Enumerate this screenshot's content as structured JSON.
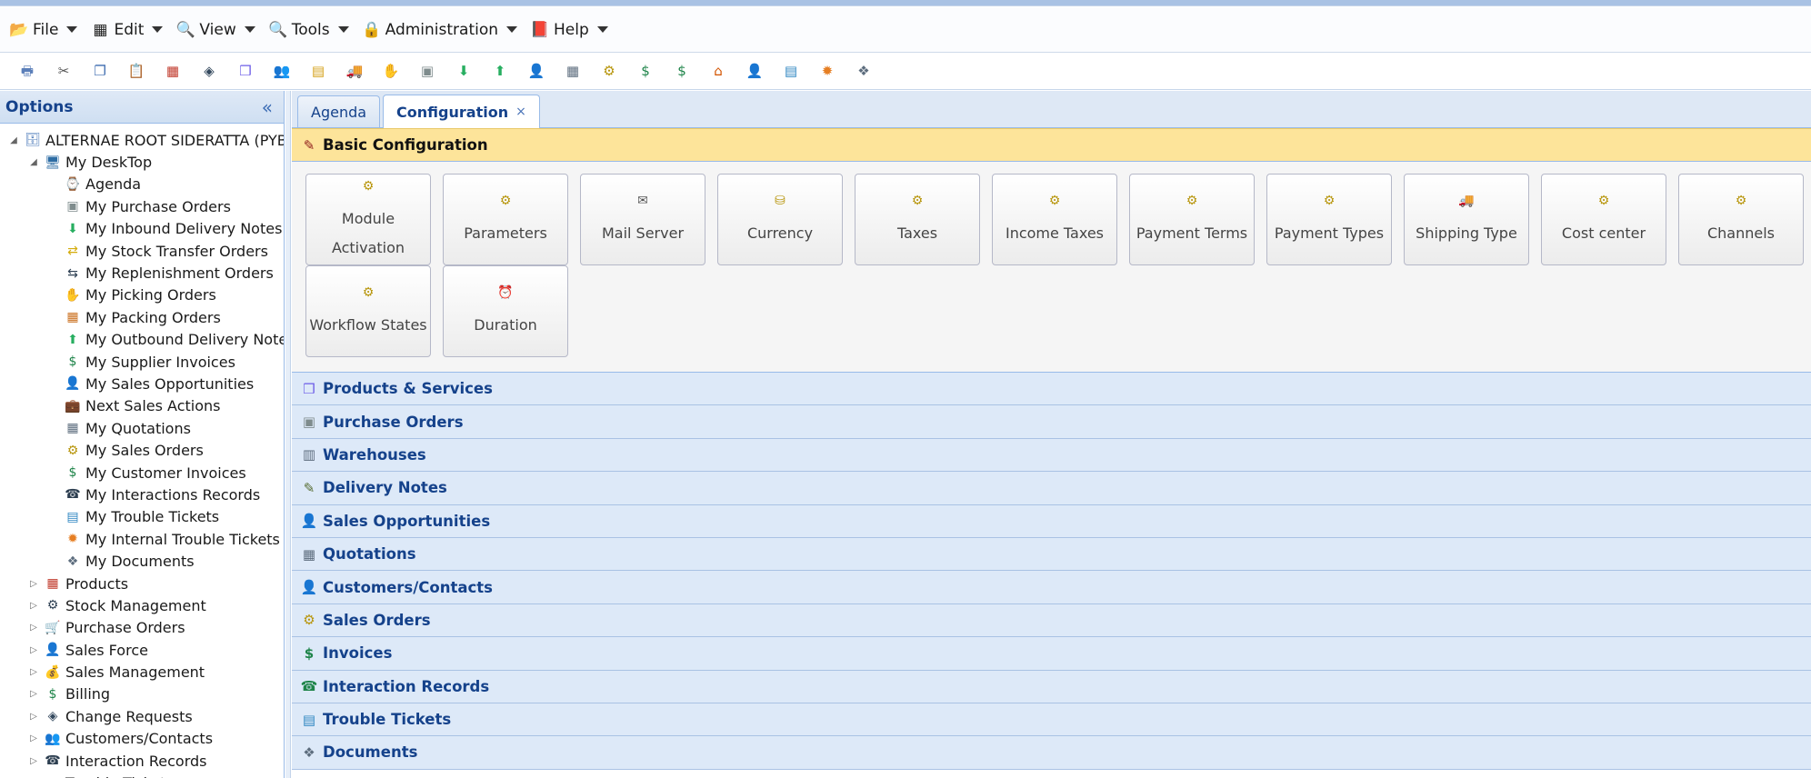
{
  "menubar": {
    "items": [
      {
        "label": "File",
        "icon": "file-icon",
        "glyph": "📂"
      },
      {
        "label": "Edit",
        "icon": "edit-icon",
        "glyph": "▦"
      },
      {
        "label": "View",
        "icon": "view-icon",
        "glyph": "🔍"
      },
      {
        "label": "Tools",
        "icon": "tools-icon",
        "glyph": "🔍"
      },
      {
        "label": "Administration",
        "icon": "lock-icon",
        "glyph": "🔒"
      },
      {
        "label": "Help",
        "icon": "help-book-icon",
        "glyph": "📕"
      }
    ]
  },
  "toolbar": {
    "buttons": [
      {
        "name": "print-icon",
        "glyph": "🖶",
        "color": "#5b7fb9"
      },
      {
        "name": "cut-icon",
        "glyph": "✂",
        "color": "#555555"
      },
      {
        "name": "copy-icon",
        "glyph": "❐",
        "color": "#3e6cb0"
      },
      {
        "name": "paste-icon",
        "glyph": "📋",
        "color": "#8a6d3b"
      },
      {
        "name": "calendar-icon",
        "glyph": "▦",
        "color": "#c0392b"
      },
      {
        "name": "stack-icon",
        "glyph": "◈",
        "color": "#34495e"
      },
      {
        "name": "product-box-icon",
        "glyph": "❒",
        "color": "#6c5ce7"
      },
      {
        "name": "users-group-icon",
        "glyph": "👥",
        "color": "#222222"
      },
      {
        "name": "notes-icon",
        "glyph": "▤",
        "color": "#d4a017"
      },
      {
        "name": "truck-icon",
        "glyph": "🚚",
        "color": "#b8860b"
      },
      {
        "name": "hand-box-icon",
        "glyph": "✋",
        "color": "#e67e22"
      },
      {
        "name": "purchase-order-icon",
        "glyph": "▣",
        "color": "#7f8c8d"
      },
      {
        "name": "inbound-icon",
        "glyph": "⬇",
        "color": "#27ae60"
      },
      {
        "name": "outbound-icon",
        "glyph": "⬆",
        "color": "#27ae60"
      },
      {
        "name": "sales-person-icon",
        "glyph": "👤",
        "color": "#8e1b1b"
      },
      {
        "name": "calculator-icon",
        "glyph": "▦",
        "color": "#5d6d7e"
      },
      {
        "name": "sales-order-icon",
        "glyph": "⚙",
        "color": "#b7950b"
      },
      {
        "name": "invoice-icon",
        "glyph": "$",
        "color": "#1e8449"
      },
      {
        "name": "customer-invoice-icon",
        "glyph": "$",
        "color": "#1e8449"
      },
      {
        "name": "warehouse-house-icon",
        "glyph": "⌂",
        "color": "#d35400"
      },
      {
        "name": "contact-person-icon",
        "glyph": "👤",
        "color": "#333333"
      },
      {
        "name": "ticket-icon",
        "glyph": "▤",
        "color": "#2e86c1"
      },
      {
        "name": "bug-icon",
        "glyph": "✹",
        "color": "#e67e22"
      },
      {
        "name": "documents-icon",
        "glyph": "❖",
        "color": "#5d6d7e"
      }
    ]
  },
  "left_panel": {
    "title": "Options",
    "tree": [
      {
        "level": 0,
        "toggle": "◢",
        "label": "ALTERNAE ROOT SIDERATTA (PYB)",
        "icon": "database-icon",
        "glyph": "🗄",
        "color": "#4a78b8"
      },
      {
        "level": 1,
        "toggle": "◢",
        "label": "My DeskTop",
        "icon": "desktop-icon",
        "glyph": "🖥",
        "color": "#2e6da4"
      },
      {
        "level": 2,
        "toggle": "",
        "label": "Agenda",
        "icon": "agenda-icon",
        "glyph": "⌚",
        "color": "#b8860b"
      },
      {
        "level": 2,
        "toggle": "",
        "label": "My Purchase Orders",
        "icon": "purchase-order-icon",
        "glyph": "▣",
        "color": "#7f8c8d"
      },
      {
        "level": 2,
        "toggle": "",
        "label": "My Inbound Delivery Notes",
        "icon": "inbound-icon",
        "glyph": "⬇",
        "color": "#27ae60"
      },
      {
        "level": 2,
        "toggle": "",
        "label": "My Stock Transfer Orders",
        "icon": "stock-transfer-icon",
        "glyph": "⇄",
        "color": "#d4ac0d"
      },
      {
        "level": 2,
        "toggle": "",
        "label": "My Replenishment Orders",
        "icon": "replenish-icon",
        "glyph": "⇆",
        "color": "#2e4053"
      },
      {
        "level": 2,
        "toggle": "",
        "label": "My Picking Orders",
        "icon": "picking-icon",
        "glyph": "✋",
        "color": "#e67e22"
      },
      {
        "level": 2,
        "toggle": "",
        "label": "My Packing Orders",
        "icon": "packing-icon",
        "glyph": "▦",
        "color": "#ca6f1e"
      },
      {
        "level": 2,
        "toggle": "",
        "label": "My Outbound Delivery Notes",
        "icon": "outbound-icon",
        "glyph": "⬆",
        "color": "#27ae60"
      },
      {
        "level": 2,
        "toggle": "",
        "label": "My Supplier Invoices",
        "icon": "invoice-icon",
        "glyph": "$",
        "color": "#1e8449"
      },
      {
        "level": 2,
        "toggle": "",
        "label": "My Sales Opportunities",
        "icon": "sales-person-icon",
        "glyph": "👤",
        "color": "#8e1b1b"
      },
      {
        "level": 2,
        "toggle": "",
        "label": "Next Sales Actions",
        "icon": "briefcase-icon",
        "glyph": "💼",
        "color": "#922b21"
      },
      {
        "level": 2,
        "toggle": "",
        "label": "My Quotations",
        "icon": "calculator-icon",
        "glyph": "▦",
        "color": "#5d6d7e"
      },
      {
        "level": 2,
        "toggle": "",
        "label": "My Sales Orders",
        "icon": "sales-order-icon",
        "glyph": "⚙",
        "color": "#b7950b"
      },
      {
        "level": 2,
        "toggle": "",
        "label": "My Customer Invoices",
        "icon": "customer-invoice-icon",
        "glyph": "$",
        "color": "#1e8449"
      },
      {
        "level": 2,
        "toggle": "",
        "label": "My Interactions Records",
        "icon": "interaction-icon",
        "glyph": "☎",
        "color": "#2c3e50"
      },
      {
        "level": 2,
        "toggle": "",
        "label": "My Trouble Tickets",
        "icon": "ticket-icon",
        "glyph": "▤",
        "color": "#2e86c1"
      },
      {
        "level": 2,
        "toggle": "",
        "label": "My Internal Trouble Tickets",
        "icon": "bug-icon",
        "glyph": "✹",
        "color": "#e67e22"
      },
      {
        "level": 2,
        "toggle": "",
        "label": "My Documents",
        "icon": "documents-icon",
        "glyph": "❖",
        "color": "#5d6d7e"
      },
      {
        "level": 1,
        "toggle": "▷",
        "label": "Products",
        "icon": "products-icon",
        "glyph": "▦",
        "color": "#c0392b"
      },
      {
        "level": 1,
        "toggle": "▷",
        "label": "Stock Management",
        "icon": "stock-icon",
        "glyph": "⚙",
        "color": "#2e4053"
      },
      {
        "level": 1,
        "toggle": "▷",
        "label": "Purchase Orders",
        "icon": "cart-icon",
        "glyph": "🛒",
        "color": "#1e8449"
      },
      {
        "level": 1,
        "toggle": "▷",
        "label": "Sales Force",
        "icon": "sales-force-icon",
        "glyph": "👤",
        "color": "#7d6608"
      },
      {
        "level": 1,
        "toggle": "▷",
        "label": "Sales Management",
        "icon": "money-bag-icon",
        "glyph": "💰",
        "color": "#b9770e"
      },
      {
        "level": 1,
        "toggle": "▷",
        "label": "Billing",
        "icon": "billing-icon",
        "glyph": "$",
        "color": "#1e8449"
      },
      {
        "level": 1,
        "toggle": "▷",
        "label": "Change Requests",
        "icon": "change-request-icon",
        "glyph": "◈",
        "color": "#34495e"
      },
      {
        "level": 1,
        "toggle": "▷",
        "label": "Customers/Contacts",
        "icon": "customers-icon",
        "glyph": "👥",
        "color": "#b9770e"
      },
      {
        "level": 1,
        "toggle": "▷",
        "label": "Interaction Records",
        "icon": "interaction-records-icon",
        "glyph": "☎",
        "color": "#2c3e50"
      },
      {
        "level": 1,
        "toggle": "▷",
        "label": "Trouble Tickets",
        "icon": "ticket-icon",
        "glyph": "▤",
        "color": "#2e86c1"
      }
    ]
  },
  "tabs": [
    {
      "label": "Agenda",
      "active": false,
      "closable": false
    },
    {
      "label": "Configuration",
      "active": true,
      "closable": true,
      "close_glyph": "×"
    }
  ],
  "basic_config": {
    "title": "Basic Configuration",
    "icon": "config-icon",
    "glyph": "✎",
    "buttons": [
      {
        "label": "Module Activation",
        "icon": "module-icon",
        "glyph": "⚙",
        "color": "#b7950b"
      },
      {
        "label": "Parameters",
        "icon": "parameters-icon",
        "glyph": "⚙",
        "color": "#b7950b"
      },
      {
        "label": "Mail Server",
        "icon": "mail-icon",
        "glyph": "✉",
        "color": "#555555"
      },
      {
        "label": "Currency",
        "icon": "currency-icon",
        "glyph": "⛁",
        "color": "#b7950b"
      },
      {
        "label": "Taxes",
        "icon": "taxes-icon",
        "glyph": "⚙",
        "color": "#b7950b"
      },
      {
        "label": "Income Taxes",
        "icon": "income-taxes-icon",
        "glyph": "⚙",
        "color": "#b7950b"
      },
      {
        "label": "Payment Terms",
        "icon": "payment-terms-icon",
        "glyph": "⚙",
        "color": "#b7950b"
      },
      {
        "label": "Payment Types",
        "icon": "payment-types-icon",
        "glyph": "⚙",
        "color": "#b7950b"
      },
      {
        "label": "Shipping Type",
        "icon": "shipping-truck-icon",
        "glyph": "🚚",
        "color": "#c0392b"
      },
      {
        "label": "Cost center",
        "icon": "cost-center-icon",
        "glyph": "⚙",
        "color": "#b7950b"
      },
      {
        "label": "Channels",
        "icon": "channels-icon",
        "glyph": "⚙",
        "color": "#b7950b"
      },
      {
        "label": "Workflow States",
        "icon": "workflow-icon",
        "glyph": "⚙",
        "color": "#b7950b"
      },
      {
        "label": "Duration",
        "icon": "clock-icon",
        "glyph": "⏰",
        "color": "#333333"
      }
    ]
  },
  "sections": [
    {
      "title": "Products & Services",
      "icon": "product-box-icon",
      "glyph": "❒",
      "color": "#6c5ce7"
    },
    {
      "title": "Purchase Orders",
      "icon": "purchase-order-icon",
      "glyph": "▣",
      "color": "#7f8c8d"
    },
    {
      "title": "Warehouses",
      "icon": "warehouse-icon",
      "glyph": "▥",
      "color": "#5d6d7e"
    },
    {
      "title": "Delivery Notes",
      "icon": "delivery-notes-icon",
      "glyph": "✎",
      "color": "#556b2f"
    },
    {
      "title": "Sales Opportunities",
      "icon": "sales-person-icon",
      "glyph": "👤",
      "color": "#8e1b1b"
    },
    {
      "title": "Quotations",
      "icon": "calculator-icon",
      "glyph": "▦",
      "color": "#5d6d7e"
    },
    {
      "title": "Customers/Contacts",
      "icon": "contact-person-icon",
      "glyph": "👤",
      "color": "#333333"
    },
    {
      "title": "Sales Orders",
      "icon": "sales-order-icon",
      "glyph": "⚙",
      "color": "#b7950b"
    },
    {
      "title": "Invoices",
      "icon": "invoice-icon",
      "glyph": "$",
      "color": "#1e8449"
    },
    {
      "title": "Interaction Records",
      "icon": "phone-icon",
      "glyph": "☎",
      "color": "#1e8449"
    },
    {
      "title": "Trouble Tickets",
      "icon": "ticket-icon",
      "glyph": "▤",
      "color": "#2e86c1"
    },
    {
      "title": "Documents",
      "icon": "documents-icon",
      "glyph": "❖",
      "color": "#5d6d7e"
    }
  ],
  "colors": {
    "accent_blue": "#15428b",
    "basic_header": "#fde49a",
    "section_header": "#dde9f8"
  }
}
